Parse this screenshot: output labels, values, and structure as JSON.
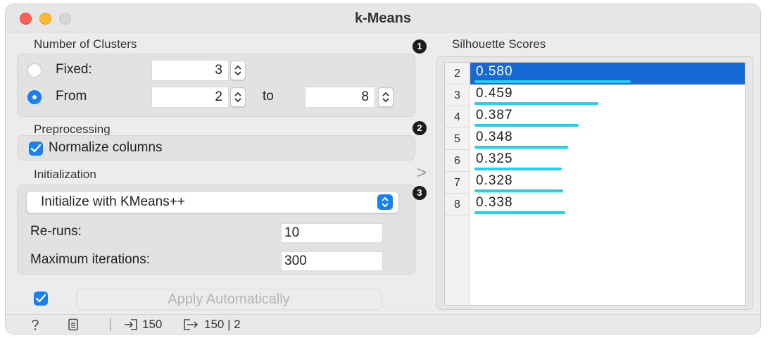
{
  "window": {
    "title": "k-Means"
  },
  "clusters": {
    "section_label": "Number of Clusters",
    "fixed_label": "Fixed:",
    "fixed_value": "3",
    "from_label": "From",
    "from_value": "2",
    "to_label": "to",
    "to_value": "8",
    "selected_mode": "From"
  },
  "preprocessing": {
    "section_label": "Preprocessing",
    "normalize_label": "Normalize columns",
    "normalize_checked": true
  },
  "initialization": {
    "section_label": "Initialization",
    "method": "Initialize with KMeans++",
    "reruns_label": "Re-runs:",
    "reruns_value": "10",
    "maxiter_label": "Maximum iterations:",
    "maxiter_value": "300"
  },
  "apply": {
    "label": "Apply Automatically",
    "auto_checked": true
  },
  "badges": {
    "b1": "1",
    "b2": "2",
    "b3": "3",
    "chevron": ">"
  },
  "silhouette": {
    "title": "Silhouette Scores",
    "selected_k": "2",
    "rows": [
      {
        "k": "2",
        "score": "0.580"
      },
      {
        "k": "3",
        "score": "0.459"
      },
      {
        "k": "4",
        "score": "0.387"
      },
      {
        "k": "5",
        "score": "0.348"
      },
      {
        "k": "6",
        "score": "0.325"
      },
      {
        "k": "7",
        "score": "0.328"
      },
      {
        "k": "8",
        "score": "0.338"
      }
    ]
  },
  "status": {
    "input_count": "150",
    "output_text": "150 | 2"
  },
  "colors": {
    "accent": "#1a7ff0",
    "selection": "#1769d6",
    "bar": "#1fd3ea"
  },
  "icons": [
    "help-icon",
    "report-icon",
    "input-icon",
    "output-icon",
    "stepper-icon",
    "checkmark-icon",
    "dropdown-arrow-icon"
  ]
}
